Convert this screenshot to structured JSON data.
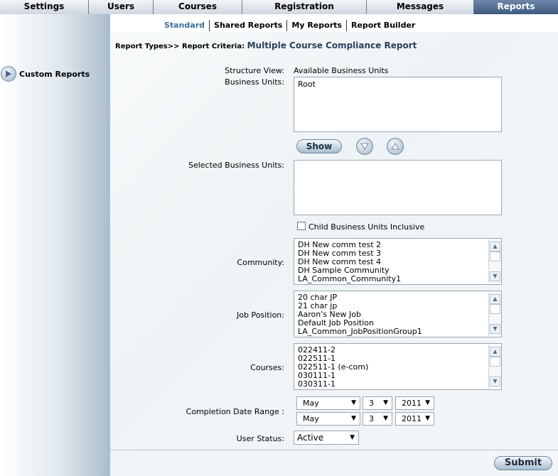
{
  "topnav": [
    {
      "label": "Settings",
      "active": false
    },
    {
      "label": "Users",
      "active": false
    },
    {
      "label": "Courses",
      "active": false
    },
    {
      "label": "Registration",
      "active": false
    },
    {
      "label": "Messages",
      "active": false
    },
    {
      "label": "Reports",
      "active": true
    }
  ],
  "subnav": [
    {
      "label": "Standard",
      "active": true
    },
    {
      "label": "Shared Reports",
      "active": false
    },
    {
      "label": "My Reports",
      "active": false
    },
    {
      "label": "Report Builder",
      "active": false
    }
  ],
  "sidebar": {
    "custom_reports_label": "Custom Reports"
  },
  "breadcrumb": {
    "report_types": "Report Types>>",
    "report_criteria": "Report Criteria:",
    "report_name": "Multiple Course Compliance Report"
  },
  "form": {
    "structure_view_label": "Structure View:",
    "structure_view_value": "Available Business Units",
    "business_units_label": "Business Units:",
    "business_units_items": [
      "Root"
    ],
    "show_button": "Show",
    "selected_business_units_label": "Selected Business Units:",
    "child_inclusive_label": "Child Business Units Inclusive",
    "child_inclusive_checked": false,
    "community_label": "Community:",
    "community_items": [
      "DH New comm test 2",
      "DH New comm test 3",
      "DH New comm test 4",
      "DH Sample Community",
      "LA_Common_Community1"
    ],
    "job_position_label": "Job Position:",
    "job_position_items": [
      "20 char JP",
      "21 char jp",
      "Aaron's New Job",
      "Default Job Position",
      "LA_Common_JobPositionGroup1"
    ],
    "courses_label": "Courses:",
    "courses_items": [
      "022411-2",
      "022511-1",
      "022511-1 (e-com)",
      "030111-1",
      "030311-1"
    ],
    "completion_date_label": "Completion Date Range :",
    "date_from": {
      "month": "May",
      "day": "3",
      "year": "2011"
    },
    "date_to": {
      "month": "May",
      "day": "3",
      "year": "2011"
    },
    "user_status_label": "User Status:",
    "user_status_value": "Active",
    "submit_button": "Submit"
  }
}
